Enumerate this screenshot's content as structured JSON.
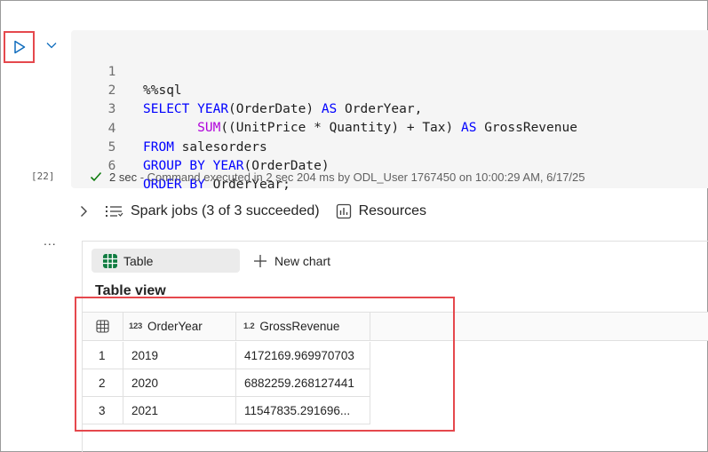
{
  "cell": {
    "run_icon": "play-icon",
    "collapse_icon": "chevron-down-icon",
    "execution_count": "[22]",
    "code_lines": [
      {
        "number": "1",
        "text": "%%sql"
      },
      {
        "number": "2",
        "text": "SELECT YEAR(OrderDate) AS OrderYear,"
      },
      {
        "number": "3",
        "text": "       SUM((UnitPrice * Quantity) + Tax) AS GrossRevenue"
      },
      {
        "number": "4",
        "text": "FROM salesorders"
      },
      {
        "number": "5",
        "text": "GROUP BY YEAR(OrderDate)"
      },
      {
        "number": "6",
        "text": "ORDER BY OrderYear;"
      }
    ],
    "status": {
      "icon": "checkmark-icon",
      "duration": "2 sec",
      "message": "- Command executed in 2 sec 204 ms by ODL_User 1767450 on 10:00:29 AM, 6/17/25"
    }
  },
  "spark": {
    "expand_icon": "chevron-right-icon",
    "jobs_label": "Spark jobs (3 of 3 succeeded)",
    "resources_label": "Resources"
  },
  "output": {
    "more_label": "...",
    "tabs": {
      "table_label": "Table",
      "new_chart_label": "New chart"
    },
    "view_title": "Table view",
    "columns": [
      {
        "type": "123",
        "name": "OrderYear"
      },
      {
        "type": "1.2",
        "name": "GrossRevenue"
      }
    ],
    "rows": [
      {
        "index": "1",
        "year": "2019",
        "revenue": "4172169.969970703"
      },
      {
        "index": "2",
        "year": "2020",
        "revenue": "6882259.268127441"
      },
      {
        "index": "3",
        "year": "2021",
        "revenue": "11547835.291696..."
      }
    ]
  },
  "colors": {
    "highlight": "#e5484d",
    "success": "#107c10",
    "keyword": "#0000ff",
    "function": "#795e26",
    "table_icon": "#107c41"
  }
}
